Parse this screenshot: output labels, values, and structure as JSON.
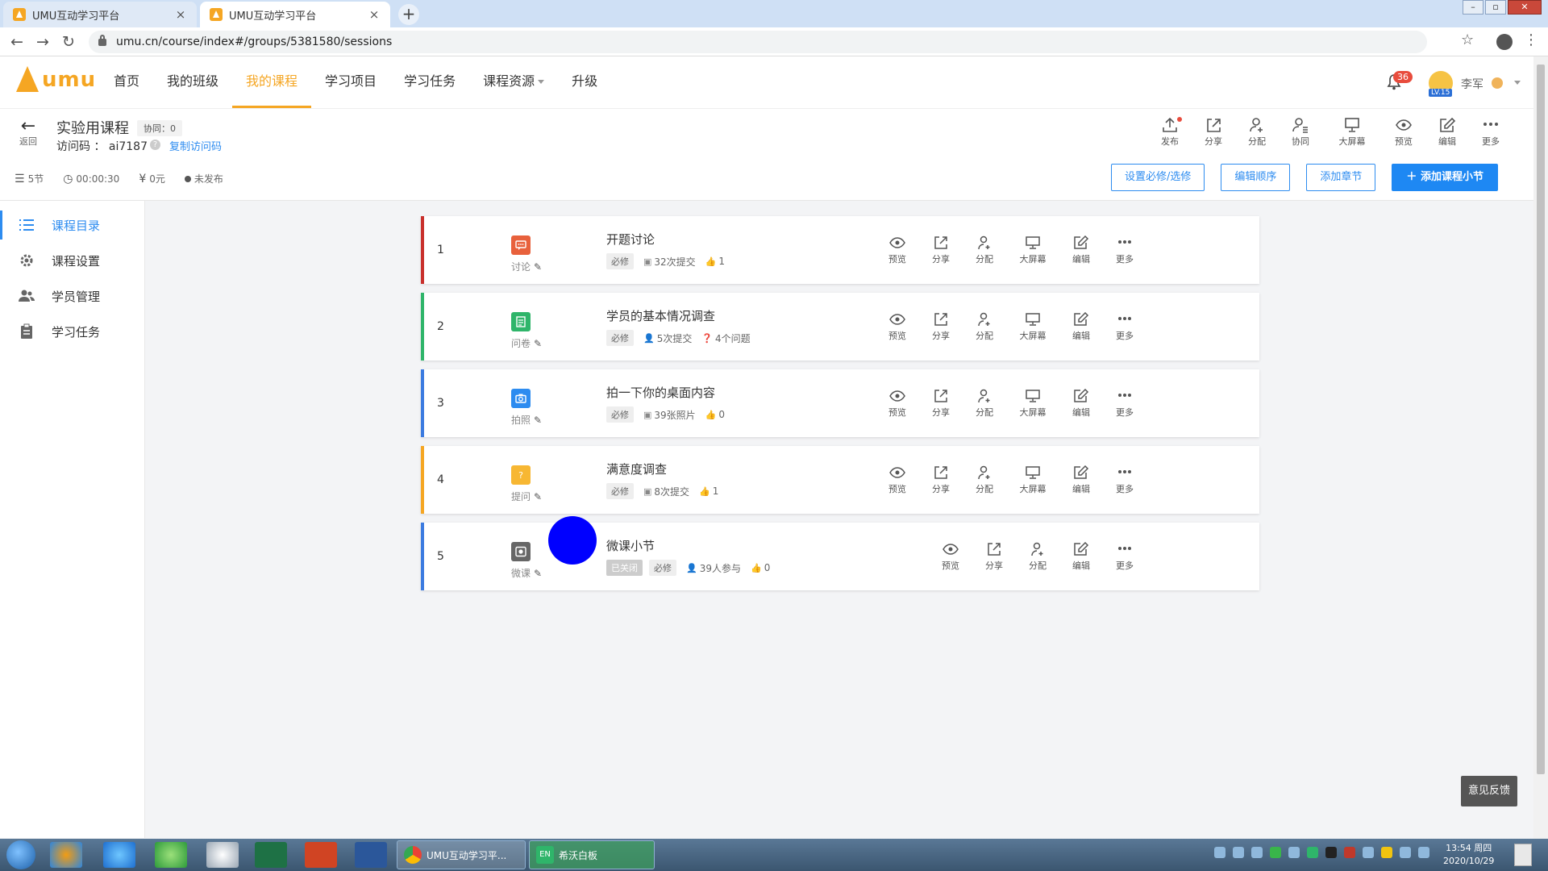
{
  "browser": {
    "tabs": [
      {
        "title": "UMU互动学习平台",
        "active": false
      },
      {
        "title": "UMU互动学习平台",
        "active": true
      }
    ],
    "url": "umu.cn/course/index#/groups/5381580/sessions"
  },
  "header": {
    "logo_text": "umu",
    "nav": [
      "首页",
      "我的班级",
      "我的课程",
      "学习项目",
      "学习任务",
      "课程资源",
      "升级"
    ],
    "active_nav": "我的课程",
    "notification_count": "36",
    "level": "LV.15",
    "user_name": "李军"
  },
  "course": {
    "back_label": "返回",
    "title": "实验用课程",
    "collab_tag": "协同：0",
    "access_label": "访问码 ： ai7187",
    "copy_link": "复制访问码",
    "meta": {
      "sections": "5节",
      "duration": "00:00:30",
      "price": "0元",
      "status": "未发布"
    },
    "tools": [
      "发布",
      "分享",
      "分配",
      "协同",
      "大屏幕",
      "预览",
      "编辑",
      "更多"
    ],
    "buttons": {
      "required": "设置必修/选修",
      "order": "编辑顺序",
      "add_chapter": "添加章节",
      "add_section": "添加课程小节"
    }
  },
  "sidebar": {
    "items": [
      {
        "label": "课程目录",
        "icon": "list-icon",
        "active": true
      },
      {
        "label": "课程设置",
        "icon": "gear-icon",
        "active": false
      },
      {
        "label": "学员管理",
        "icon": "users-icon",
        "active": false
      },
      {
        "label": "学习任务",
        "icon": "clipboard-icon",
        "active": false
      }
    ]
  },
  "sessions": [
    {
      "num": "1",
      "type": "讨论",
      "color": "#e8613c",
      "bar": "#c9302c",
      "title": "开题讨论",
      "closed": null,
      "required": "必修",
      "stat1": "32次提交",
      "stat2": "1",
      "stat2_icon": "like",
      "actions": [
        "预览",
        "分享",
        "分配",
        "大屏幕",
        "编辑",
        "更多"
      ]
    },
    {
      "num": "2",
      "type": "问卷",
      "color": "#2fb56a",
      "bar": "#2fb56a",
      "title": "学员的基本情况调查",
      "closed": null,
      "required": "必修",
      "stat1": "5次提交",
      "stat2": "4个问题",
      "stat2_icon": "question",
      "actions": [
        "预览",
        "分享",
        "分配",
        "大屏幕",
        "编辑",
        "更多"
      ]
    },
    {
      "num": "3",
      "type": "拍照",
      "color": "#2d8cf0",
      "bar": "#3b7be0",
      "title": "拍一下你的桌面内容",
      "closed": null,
      "required": "必修",
      "stat1": "39张照片",
      "stat2": "0",
      "stat2_icon": "like",
      "actions": [
        "预览",
        "分享",
        "分配",
        "大屏幕",
        "编辑",
        "更多"
      ]
    },
    {
      "num": "4",
      "type": "提问",
      "color": "#f7b733",
      "bar": "#f5a623",
      "title": "满意度调查",
      "closed": null,
      "required": "必修",
      "stat1": "8次提交",
      "stat2": "1",
      "stat2_icon": "like",
      "actions": [
        "预览",
        "分享",
        "分配",
        "大屏幕",
        "编辑",
        "更多"
      ]
    },
    {
      "num": "5",
      "type": "微课",
      "color": "#666666",
      "bar": "#3b7be0",
      "title": "微课小节",
      "closed": "已关闭",
      "required": "必修",
      "stat1": "39人参与",
      "stat2": "0",
      "stat2_icon": "like",
      "actions": [
        "预览",
        "分享",
        "分配",
        "编辑",
        "更多"
      ]
    }
  ],
  "feedback": "意见反馈",
  "taskbar": {
    "windows": [
      "UMU互动学习平...",
      "希沃白板"
    ],
    "ime": "EN",
    "time": "13:54 周四",
    "date": "2020/10/29"
  }
}
